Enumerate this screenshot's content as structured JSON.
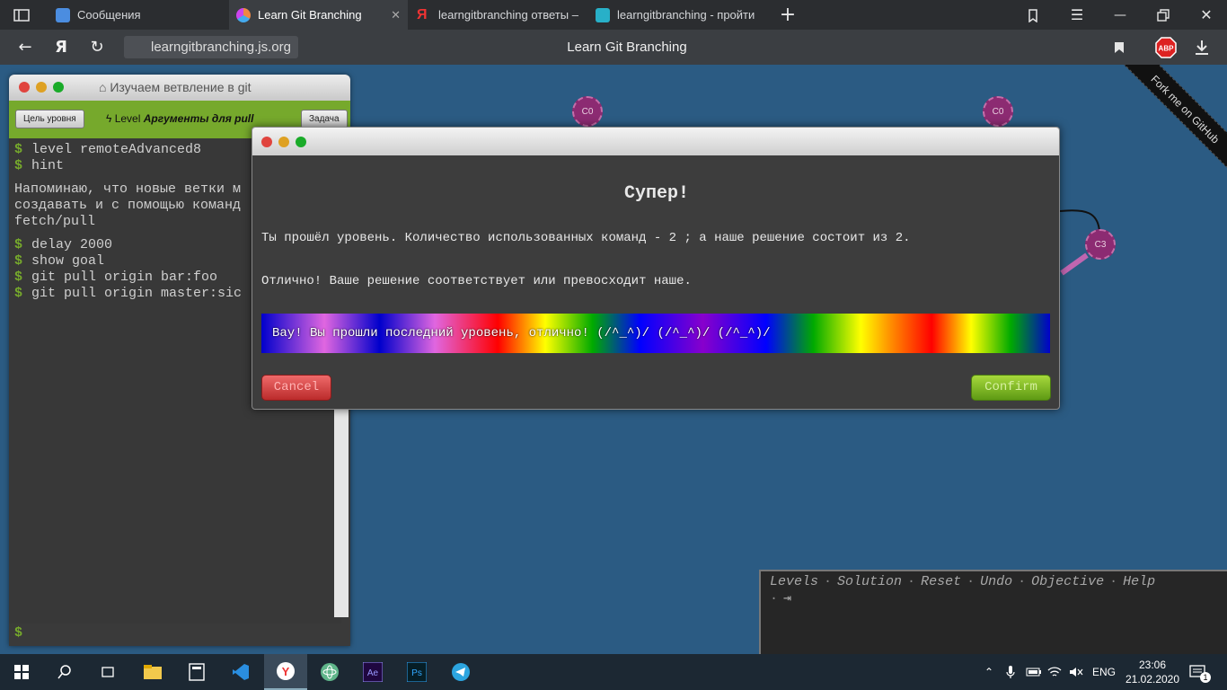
{
  "browser": {
    "tabs": [
      {
        "label": "Сообщения",
        "icon": "chat-icon"
      },
      {
        "label": "Learn Git Branching",
        "icon": "git-icon"
      },
      {
        "label": "learngitbranching ответы –",
        "icon": "yandex-icon"
      },
      {
        "label": "learngitbranching - пройти",
        "icon": "site-icon"
      }
    ],
    "url": "learngitbranching.js.org",
    "title": "Learn Git Branching"
  },
  "terminal": {
    "title": "Изучаем ветвление в git",
    "goal_button": "Цель уровня",
    "level_prefix": "Level",
    "level_name": "Аргументы для pull",
    "task_button": "Задача",
    "commands_top": [
      "level remoteAdvanced8",
      "hint"
    ],
    "hint_lines": [
      "Напоминаю, что новые ветки м",
      "создавать и с помощью команд",
      "fetch/pull"
    ],
    "commands_bottom": [
      "delay 2000",
      "show goal",
      "git pull origin bar:foo",
      "git pull origin master:sic"
    ],
    "prompt": "$"
  },
  "graph": {
    "commits": [
      "C0",
      "C0",
      "C3"
    ]
  },
  "ribbon": "Fork me on GitHub",
  "modal": {
    "heading": "Супер!",
    "line1": "Ты прошёл уровень. Количество использованных команд - 2 ; а наше решение состоит из 2.",
    "line2": "Отлично! Ваше решение соответствует или превосходит наше.",
    "banner": "Вау! Вы прошли последний уровень, отлично! (/^_^)/ (/^_^)/ (/^_^)/",
    "cancel": "Cancel",
    "confirm": "Confirm"
  },
  "command_panel": {
    "items": [
      "Levels",
      "Solution",
      "Reset",
      "Undo",
      "Objective",
      "Help"
    ]
  },
  "taskbar": {
    "lang": "ENG",
    "time": "23:06",
    "date": "21.02.2020",
    "notifications": "1"
  }
}
